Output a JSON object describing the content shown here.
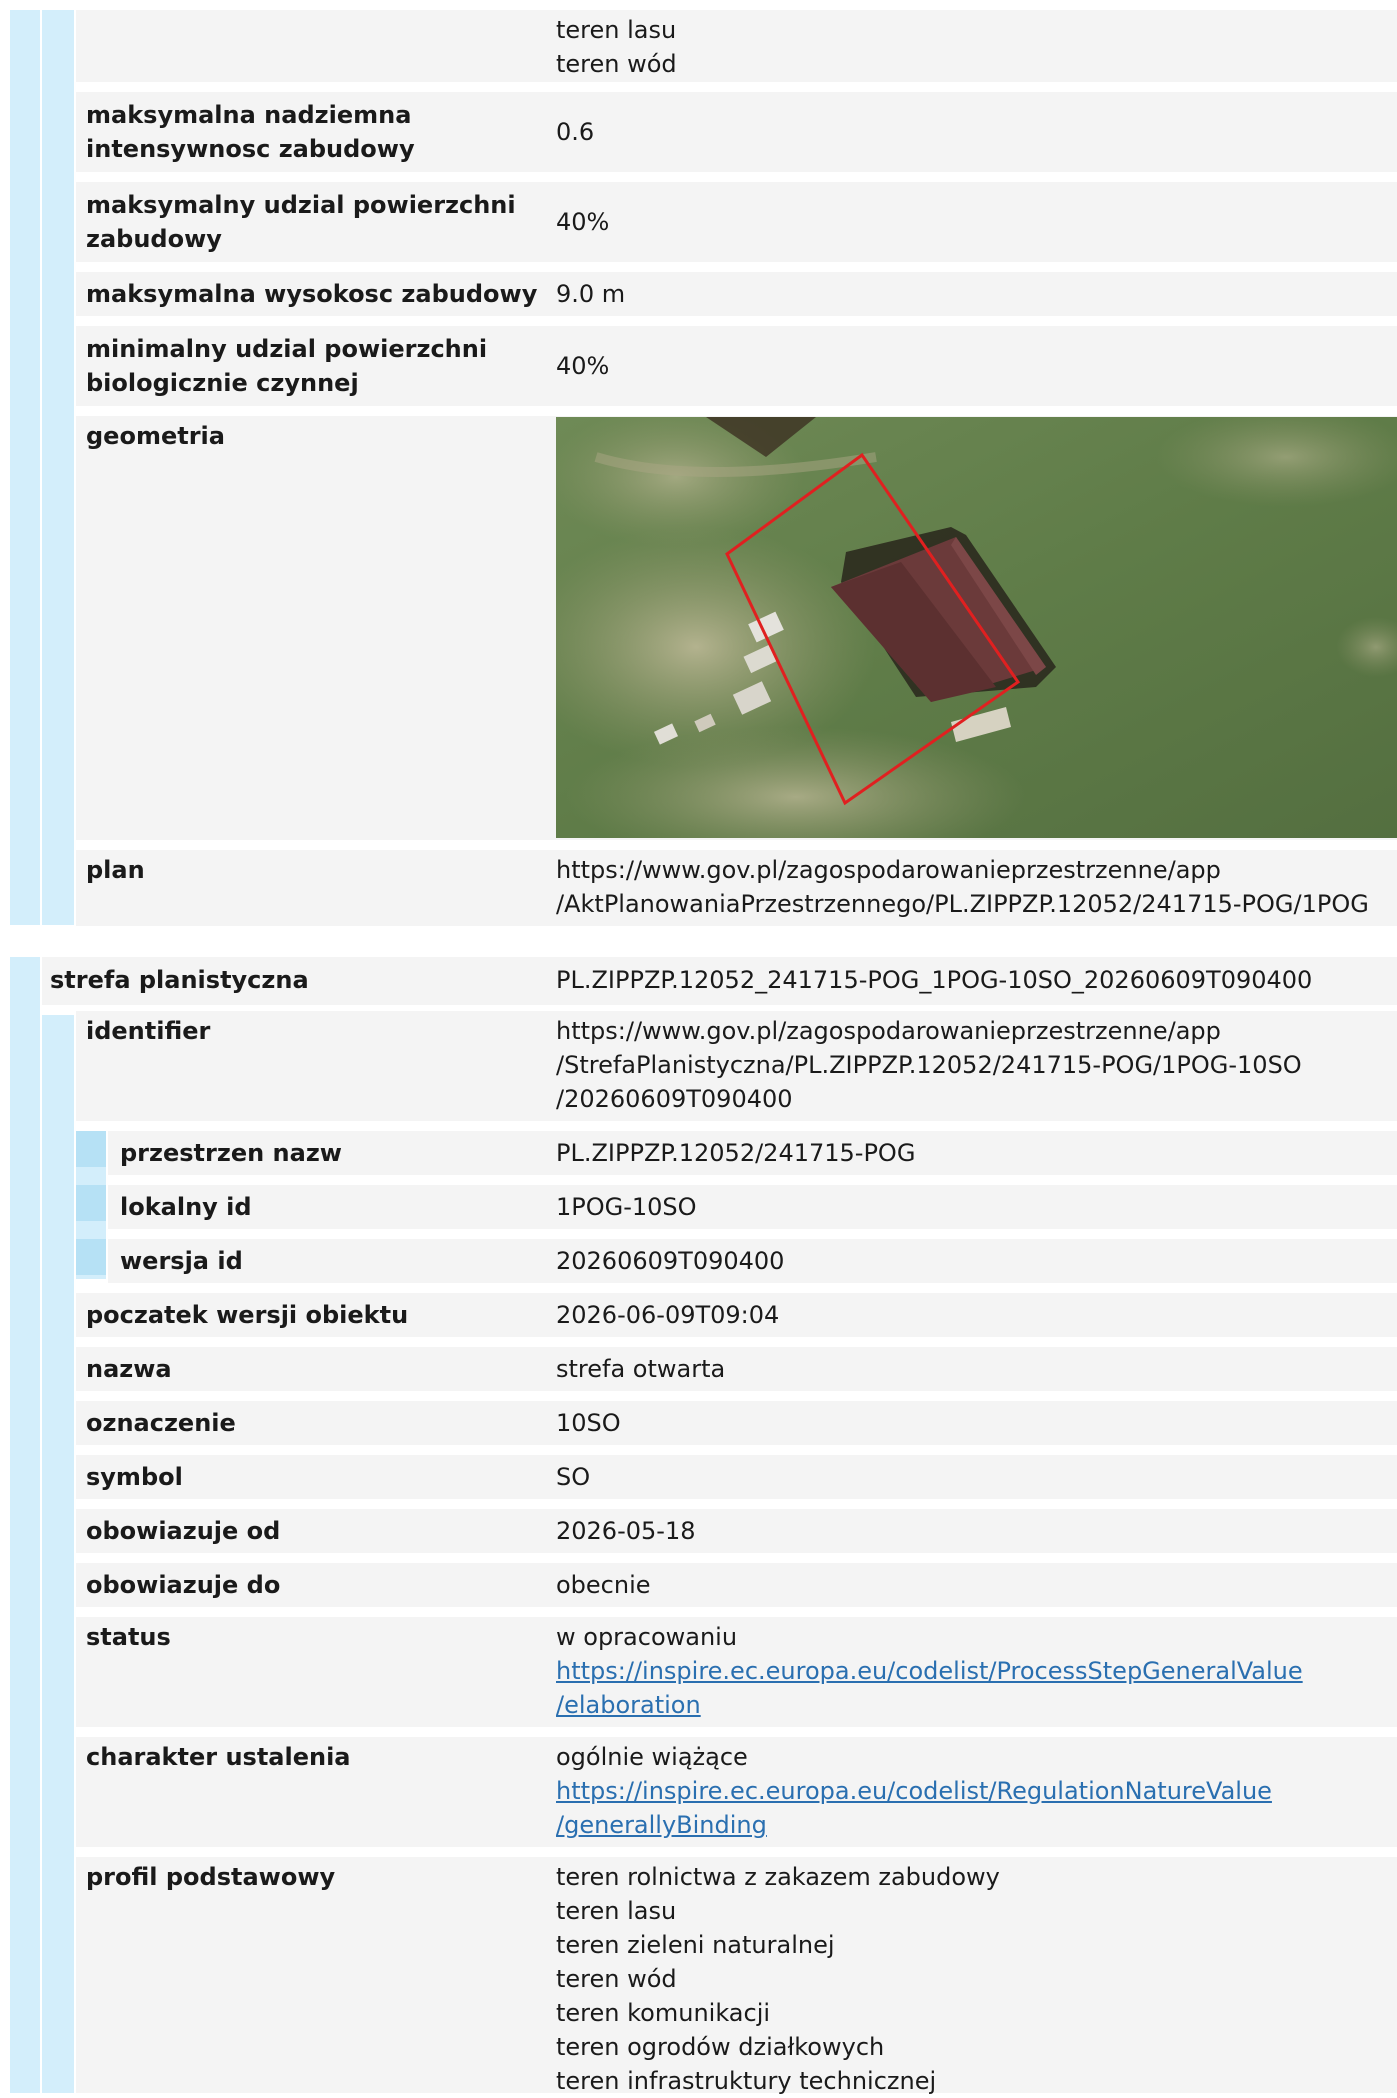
{
  "section1": {
    "top_values": [
      "teren lasu",
      "teren wód"
    ],
    "rows": [
      {
        "label_lines": [
          "maksymalna nadziemna",
          "intensywnosc zabudowy"
        ],
        "value": "0.6"
      },
      {
        "label_lines": [
          "maksymalny udzial powierzchni",
          "zabudowy"
        ],
        "value": "40%"
      },
      {
        "label_lines": [
          "maksymalna wysokosc zabudowy"
        ],
        "value": "9.0 m"
      },
      {
        "label_lines": [
          "minimalny udzial powierzchni",
          "biologicznie czynnej"
        ],
        "value": "40%"
      }
    ],
    "geometria_label": "geometria",
    "plan_label": "plan",
    "plan_value_lines": [
      "https://www.gov.pl/zagospodarowanieprzestrzenne/app",
      "/AktPlanowaniaPrzestrzennego/PL.ZIPPZP.12052/241715-POG/1POG"
    ]
  },
  "section2": {
    "header_label": "strefa planistyczna",
    "header_value": "PL.ZIPPZP.12052_241715-POG_1POG-10SO_20260609T090400",
    "identifier_label": "identifier",
    "identifier_value_lines": [
      "https://www.gov.pl/zagospodarowanieprzestrzenne/app",
      "/StrefaPlanistyczna/PL.ZIPPZP.12052/241715-POG/1POG-10SO",
      "/20260609T090400"
    ],
    "sub_rows": [
      {
        "label": "przestrzen nazw",
        "value": "PL.ZIPPZP.12052/241715-POG"
      },
      {
        "label": "lokalny id",
        "value": "1POG-10SO"
      },
      {
        "label": "wersja id",
        "value": "20260609T090400"
      }
    ],
    "rows": [
      {
        "label": "poczatek wersji obiektu",
        "value": "2026-06-09T09:04"
      },
      {
        "label": "nazwa",
        "value": "strefa otwarta"
      },
      {
        "label": "oznaczenie",
        "value": "10SO"
      },
      {
        "label": "symbol",
        "value": "SO"
      },
      {
        "label": "obowiazuje od",
        "value": "2026-05-18"
      },
      {
        "label": "obowiazuje do",
        "value": "obecnie"
      }
    ],
    "status": {
      "label": "status",
      "value": "w opracowaniu",
      "link_lines": [
        "https://inspire.ec.europa.eu/codelist/ProcessStepGeneralValue",
        "/elaboration"
      ]
    },
    "charakter": {
      "label": "charakter ustalenia",
      "value": "ogólnie wiążące",
      "link_lines": [
        "https://inspire.ec.europa.eu/codelist/RegulationNatureValue",
        "/generallyBinding"
      ]
    },
    "profil": {
      "label": "profil podstawowy",
      "values": [
        "teren rolnictwa z zakazem zabudowy",
        "teren lasu",
        "teren zieleni naturalnej",
        "teren wód",
        "teren komunikacji",
        "teren ogrodów działkowych",
        "teren infrastruktury technicznej"
      ]
    }
  },
  "colors": {
    "bar": "#d3eefb",
    "bar_dark": "#b6e1f5",
    "row_bg": "#f4f4f4",
    "link": "#2a6fb0",
    "polygon": "#e02020"
  }
}
